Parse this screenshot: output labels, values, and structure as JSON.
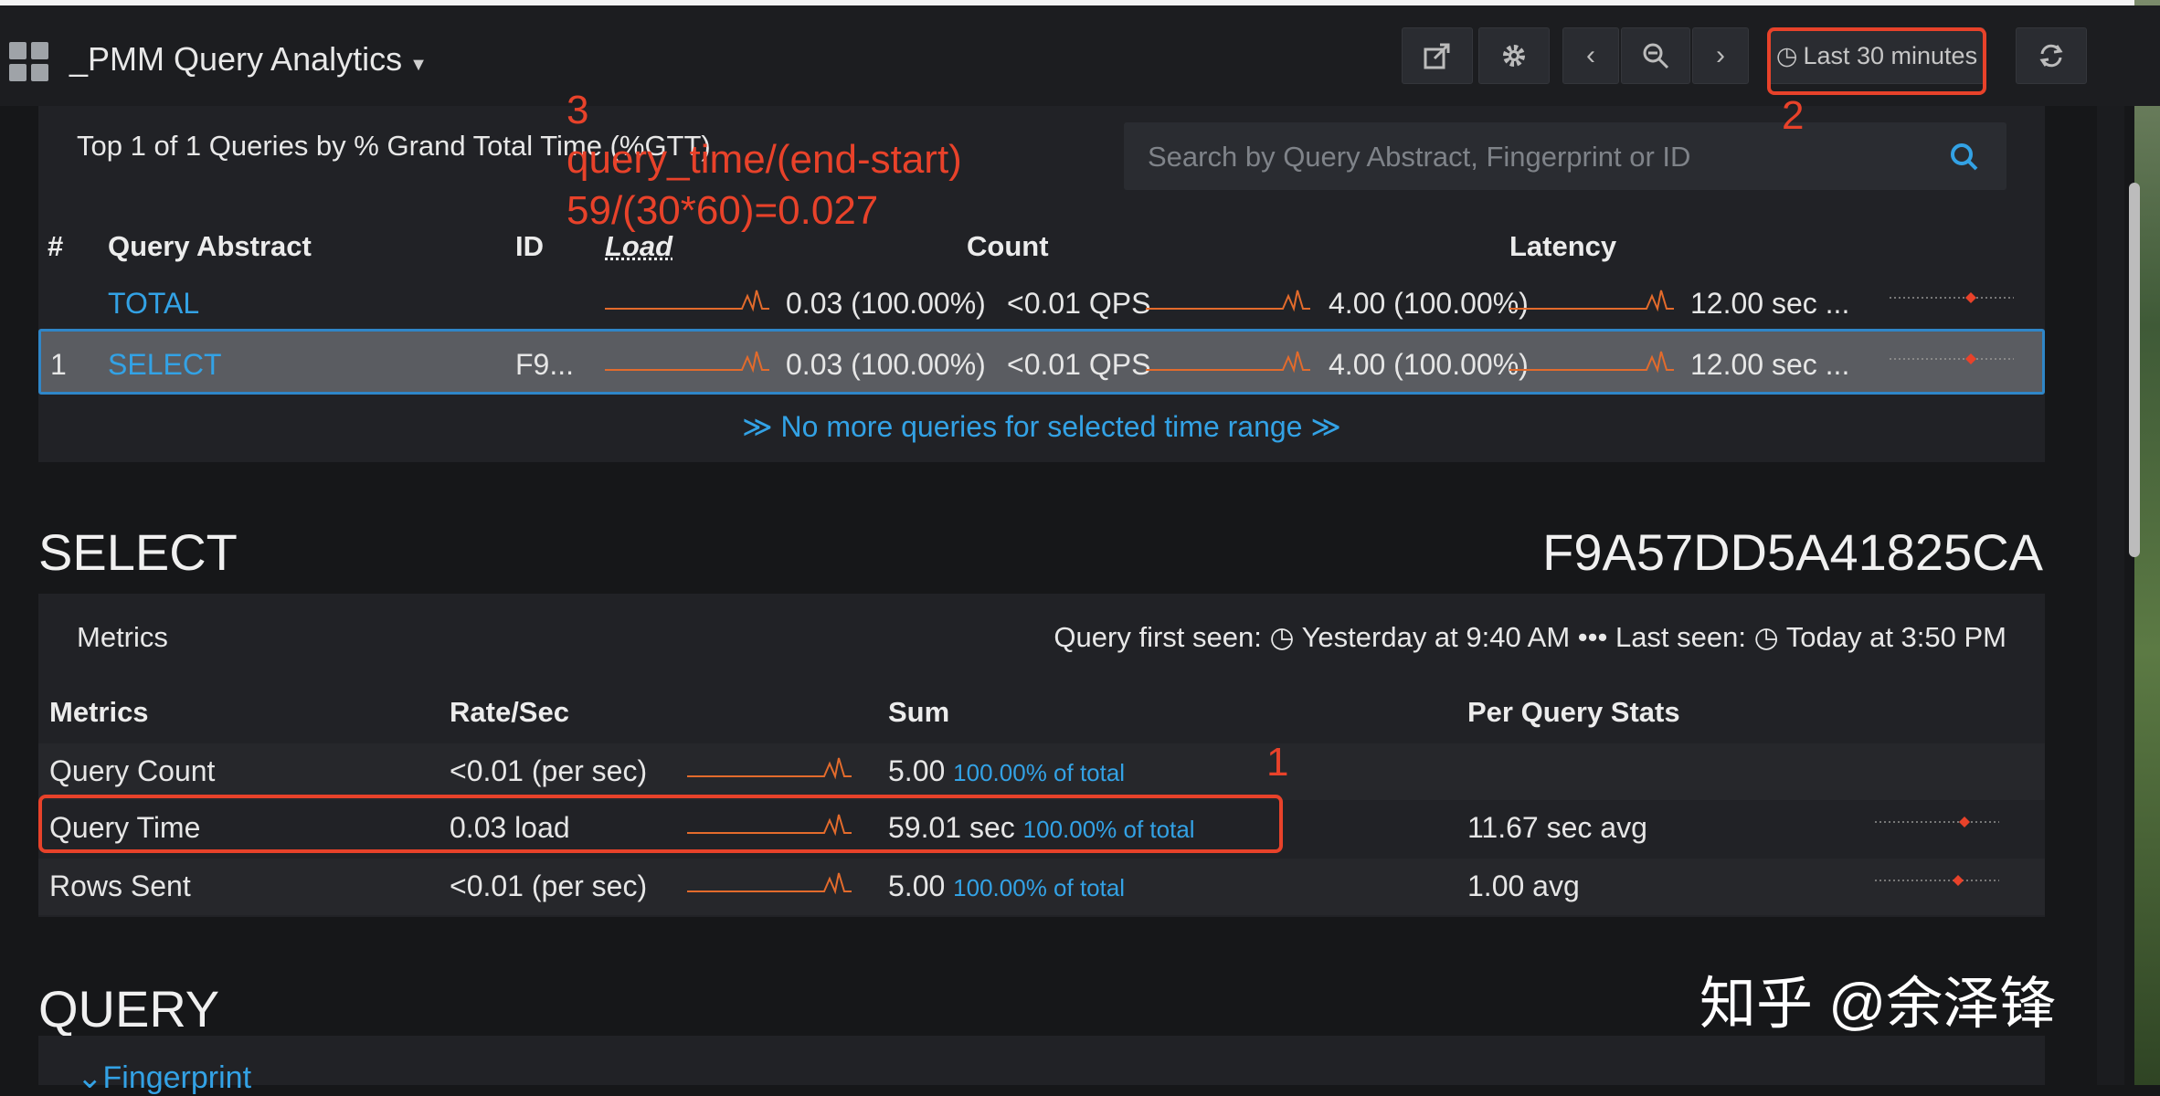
{
  "app": {
    "title": "_PMM Query Analytics"
  },
  "toolbar": {
    "share_icon": "share-icon",
    "settings_icon": "gear-icon",
    "zoom_icon": "zoom-out-icon",
    "time_range_label": "Last 30 minutes",
    "refresh_icon": "refresh-icon"
  },
  "query_list": {
    "heading": "Top 1 of 1 Queries by % Grand Total Time (%GTT)",
    "search_placeholder": "Search by Query Abstract, Fingerprint or ID",
    "columns": {
      "num": "#",
      "abstract": "Query Abstract",
      "id": "ID",
      "load": "Load",
      "count": "Count",
      "latency": "Latency"
    },
    "rows": [
      {
        "num": "",
        "abstract": "TOTAL",
        "id": "",
        "load": "0.03 (100.00%)",
        "qps": "<0.01 QPS",
        "count": "4.00 (100.00%)",
        "latency": "12.00 sec ..."
      },
      {
        "num": "1",
        "abstract": "SELECT",
        "id": "F9...",
        "load": "0.03 (100.00%)",
        "qps": "<0.01 QPS",
        "count": "4.00 (100.00%)",
        "latency": "12.00 sec ..."
      }
    ],
    "no_more": "≫ No more queries for selected time range ≫"
  },
  "detail": {
    "title": "SELECT",
    "query_id": "F9A57DD5A41825CA",
    "metrics_label": "Metrics",
    "first_seen_label": "Query first seen:",
    "first_seen": "Yesterday at 9:40 AM",
    "separator": "•••",
    "last_seen_label": "Last seen:",
    "last_seen": "Today at 3:50 PM",
    "columns": {
      "metrics": "Metrics",
      "rate": "Rate/Sec",
      "sum": "Sum",
      "per_query": "Per Query Stats"
    },
    "rows": [
      {
        "name": "Query Count",
        "rate": "<0.01 (per sec)",
        "sum": "5.00",
        "pct": "100.00% of total",
        "per_query": ""
      },
      {
        "name": "Query Time",
        "rate": "0.03 load",
        "sum": "59.01 sec",
        "pct": "100.00% of total",
        "per_query": "11.67 sec avg"
      },
      {
        "name": "Rows Sent",
        "rate": "<0.01 (per sec)",
        "sum": "5.00",
        "pct": "100.00% of total",
        "per_query": "1.00  avg"
      }
    ]
  },
  "query_section": {
    "title": "QUERY",
    "fingerprint_label": "Fingerprint"
  },
  "annotations": {
    "n1": "1",
    "n2": "2",
    "n3": "3",
    "formula1": "query_time/(end-start)",
    "formula2": "59/(30*60)=0.027"
  },
  "watermark": "知乎 @余泽锋",
  "colors": {
    "accent": "#33a2e5",
    "sparkline": "#e36b2c",
    "annotation": "#e8422a",
    "background": "#161719"
  }
}
